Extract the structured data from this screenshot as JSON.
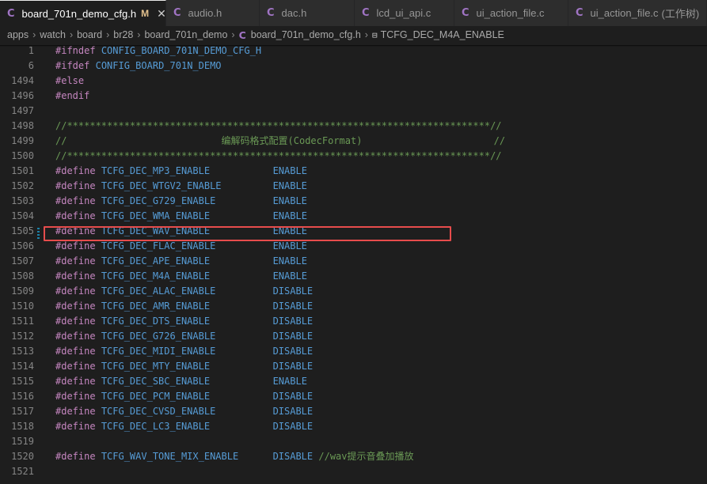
{
  "tabs": [
    {
      "label": "board_701n_demo_cfg.h",
      "icon": "c-file-icon",
      "active": true,
      "modified": "M",
      "close": "✕"
    },
    {
      "label": "audio.h",
      "icon": "c-file-icon"
    },
    {
      "label": "dac.h",
      "icon": "c-file-icon"
    },
    {
      "label": "lcd_ui_api.c",
      "icon": "c-file-icon"
    },
    {
      "label": "ui_action_file.c",
      "icon": "c-file-icon"
    },
    {
      "label": "ui_action_file.c",
      "icon": "c-file-icon",
      "extra": "(工作树)"
    }
  ],
  "breadcrumb": {
    "parts": [
      "apps",
      "watch",
      "board",
      "br28",
      "board_701n_demo"
    ],
    "file": "board_701n_demo_cfg.h",
    "symbol": "TCFG_DEC_M4A_ENABLE"
  },
  "lines": [
    {
      "num": "1",
      "kw": "#ifndef",
      "mac": "CONFIG_BOARD_701N_DEMO_CFG_H"
    },
    {
      "num": "6",
      "kw": "#ifdef",
      "mac": "CONFIG_BOARD_701N_DEMO"
    },
    {
      "num": "1494",
      "kw": "#else"
    },
    {
      "num": "1496",
      "kw": "#endif"
    },
    {
      "num": "1497"
    },
    {
      "num": "1498",
      "cm": "//**************************************************************************//"
    },
    {
      "num": "1499",
      "cm": "//                           编解码格式配置(CodecFormat)                       //"
    },
    {
      "num": "1500",
      "cm": "//**************************************************************************//"
    },
    {
      "num": "1501",
      "kw": "#define",
      "mac": "TCFG_DEC_MP3_ENABLE",
      "val": "ENABLE"
    },
    {
      "num": "1502",
      "kw": "#define",
      "mac": "TCFG_DEC_WTGV2_ENABLE",
      "val": "ENABLE"
    },
    {
      "num": "1503",
      "kw": "#define",
      "mac": "TCFG_DEC_G729_ENABLE",
      "val": "ENABLE"
    },
    {
      "num": "1504",
      "kw": "#define",
      "mac": "TCFG_DEC_WMA_ENABLE",
      "val": "ENABLE"
    },
    {
      "num": "1505",
      "kw": "#define",
      "mac": "TCFG_DEC_WAV_ENABLE",
      "val": "ENABLE"
    },
    {
      "num": "1506",
      "kw": "#define",
      "mac": "TCFG_DEC_FLAC_ENABLE",
      "val": "ENABLE"
    },
    {
      "num": "1507",
      "kw": "#define",
      "mac": "TCFG_DEC_APE_ENABLE",
      "val": "ENABLE"
    },
    {
      "num": "1508",
      "kw": "#define",
      "mac": "TCFG_DEC_M4A_ENABLE",
      "val": "ENABLE"
    },
    {
      "num": "1509",
      "kw": "#define",
      "mac": "TCFG_DEC_ALAC_ENABLE",
      "val": "DISABLE"
    },
    {
      "num": "1510",
      "kw": "#define",
      "mac": "TCFG_DEC_AMR_ENABLE",
      "val": "DISABLE"
    },
    {
      "num": "1511",
      "kw": "#define",
      "mac": "TCFG_DEC_DTS_ENABLE",
      "val": "DISABLE"
    },
    {
      "num": "1512",
      "kw": "#define",
      "mac": "TCFG_DEC_G726_ENABLE",
      "val": "DISABLE"
    },
    {
      "num": "1513",
      "kw": "#define",
      "mac": "TCFG_DEC_MIDI_ENABLE",
      "val": "DISABLE"
    },
    {
      "num": "1514",
      "kw": "#define",
      "mac": "TCFG_DEC_MTY_ENABLE",
      "val": "DISABLE"
    },
    {
      "num": "1515",
      "kw": "#define",
      "mac": "TCFG_DEC_SBC_ENABLE",
      "val": "ENABLE"
    },
    {
      "num": "1516",
      "kw": "#define",
      "mac": "TCFG_DEC_PCM_ENABLE",
      "val": "DISABLE"
    },
    {
      "num": "1517",
      "kw": "#define",
      "mac": "TCFG_DEC_CVSD_ENABLE",
      "val": "DISABLE"
    },
    {
      "num": "1518",
      "kw": "#define",
      "mac": "TCFG_DEC_LC3_ENABLE",
      "val": "DISABLE"
    },
    {
      "num": "1519"
    },
    {
      "num": "1520",
      "kw": "#define",
      "mac": "TCFG_WAV_TONE_MIX_ENABLE",
      "val": "DISABLE",
      "cm": "//wav提示音叠加播放"
    },
    {
      "num": "1521"
    }
  ],
  "colors": {
    "editor_bg": "#1e1e1e",
    "keyword": "#c586c0",
    "macro": "#569cd6",
    "comment": "#6a9955",
    "highlight_box": "#e74c4c",
    "c_icon": "#a074c4"
  }
}
